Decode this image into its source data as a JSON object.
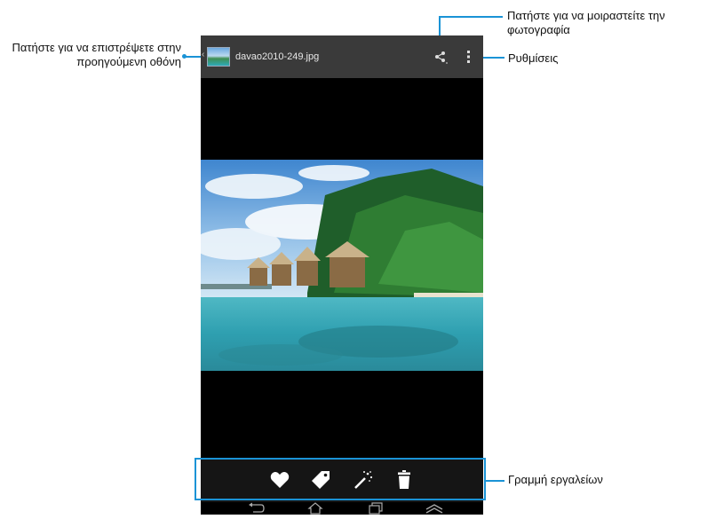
{
  "callouts": {
    "back": "Πατήστε για να επιστρέψετε στην προηγούμενη οθόνη",
    "share": "Πατήστε για να μοιραστείτε την φωτογραφία",
    "settings": "Ρυθμίσεις",
    "toolbar": "Γραμμή εργαλείων"
  },
  "actionbar": {
    "title": "davao2010-249.jpg",
    "icons": [
      "back-chevron-icon",
      "thumbnail-icon",
      "share-icon",
      "overflow-menu-icon"
    ]
  },
  "toolbar": {
    "icons": [
      "heart-icon",
      "tag-icon",
      "magic-wand-icon",
      "trash-icon"
    ]
  },
  "navbar": {
    "icons": [
      "back-icon",
      "home-icon",
      "recent-apps-icon",
      "menu-up-icon"
    ]
  },
  "colors": {
    "accent": "#1a93d6",
    "actionbar": "#3a3a3a",
    "toolbar": "#151515"
  }
}
